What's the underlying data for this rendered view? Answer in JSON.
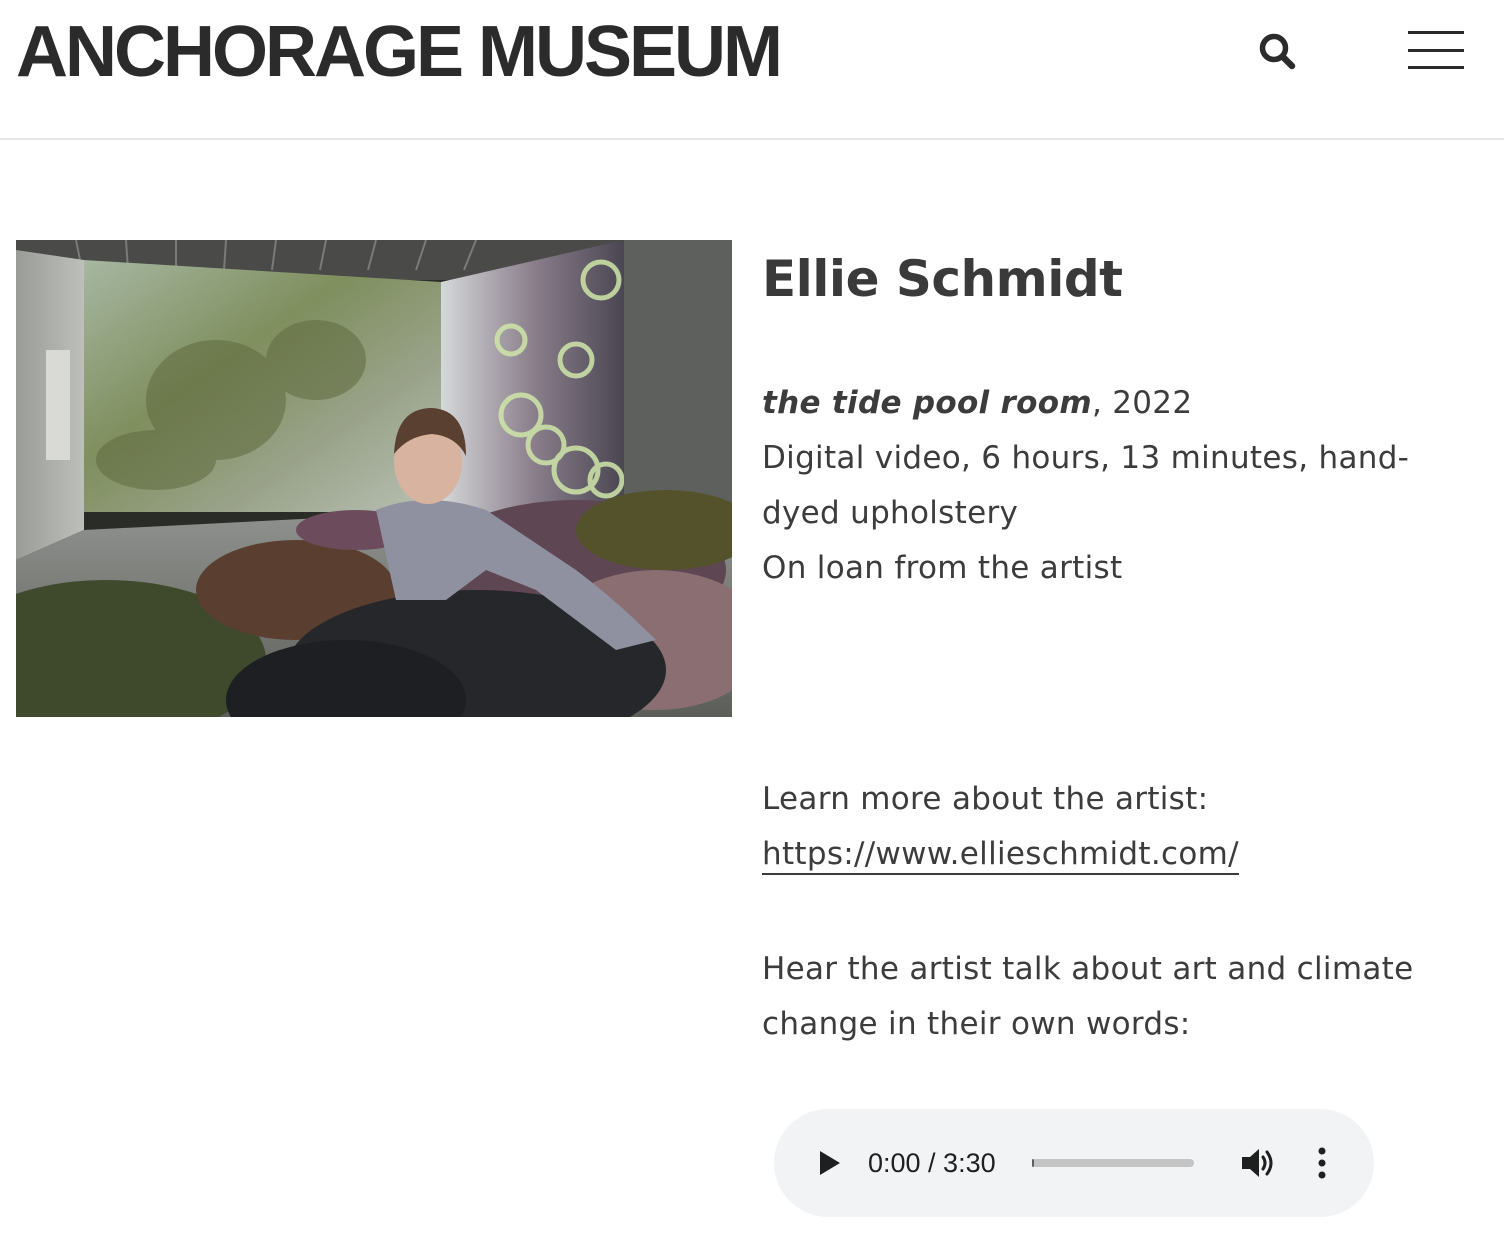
{
  "header": {
    "logo_text": "ANCHORAGE MUSEUM",
    "search_icon": "search-icon",
    "menu_icon": "hamburger-menu-icon"
  },
  "artwork_image": {
    "icon": "photo"
  },
  "artist": {
    "name": "Ellie Schmidt"
  },
  "work": {
    "title": "the tide pool room",
    "year_suffix": ", 2022",
    "medium_line1": "Digital video, 6 hours, 13 minutes, hand-",
    "medium_line2": "dyed upholstery",
    "credit": "On loan from the artist"
  },
  "learn_more": {
    "label": "Learn more about the artist:",
    "url_text": "https://www.ellieschmidt.com/"
  },
  "audio_intro": {
    "line1": "Hear the artist talk about art and climate",
    "line2": "change in their own words:"
  },
  "audio_player": {
    "time": "0:00 / 3:30",
    "progress": 0.0,
    "colors": {
      "background": "#f1f3f4",
      "track": "#c4c4c4"
    }
  },
  "colors": {
    "text": "#333333",
    "divider": "#e6e6e6"
  }
}
